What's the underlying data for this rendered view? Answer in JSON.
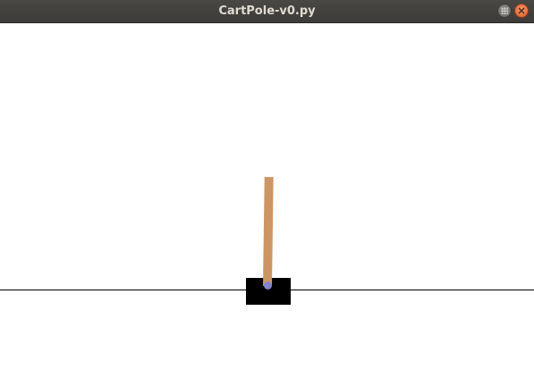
{
  "window": {
    "title": "CartPole-v0.py",
    "buttons": {
      "maximize_icon": "maximize-icon",
      "close_icon": "close-icon"
    }
  },
  "scene": {
    "background_color": "#ffffff",
    "track_color": "#000000",
    "cart_color": "#000000",
    "pole_color": "#cc9664",
    "axle_color": "#8184cb"
  }
}
